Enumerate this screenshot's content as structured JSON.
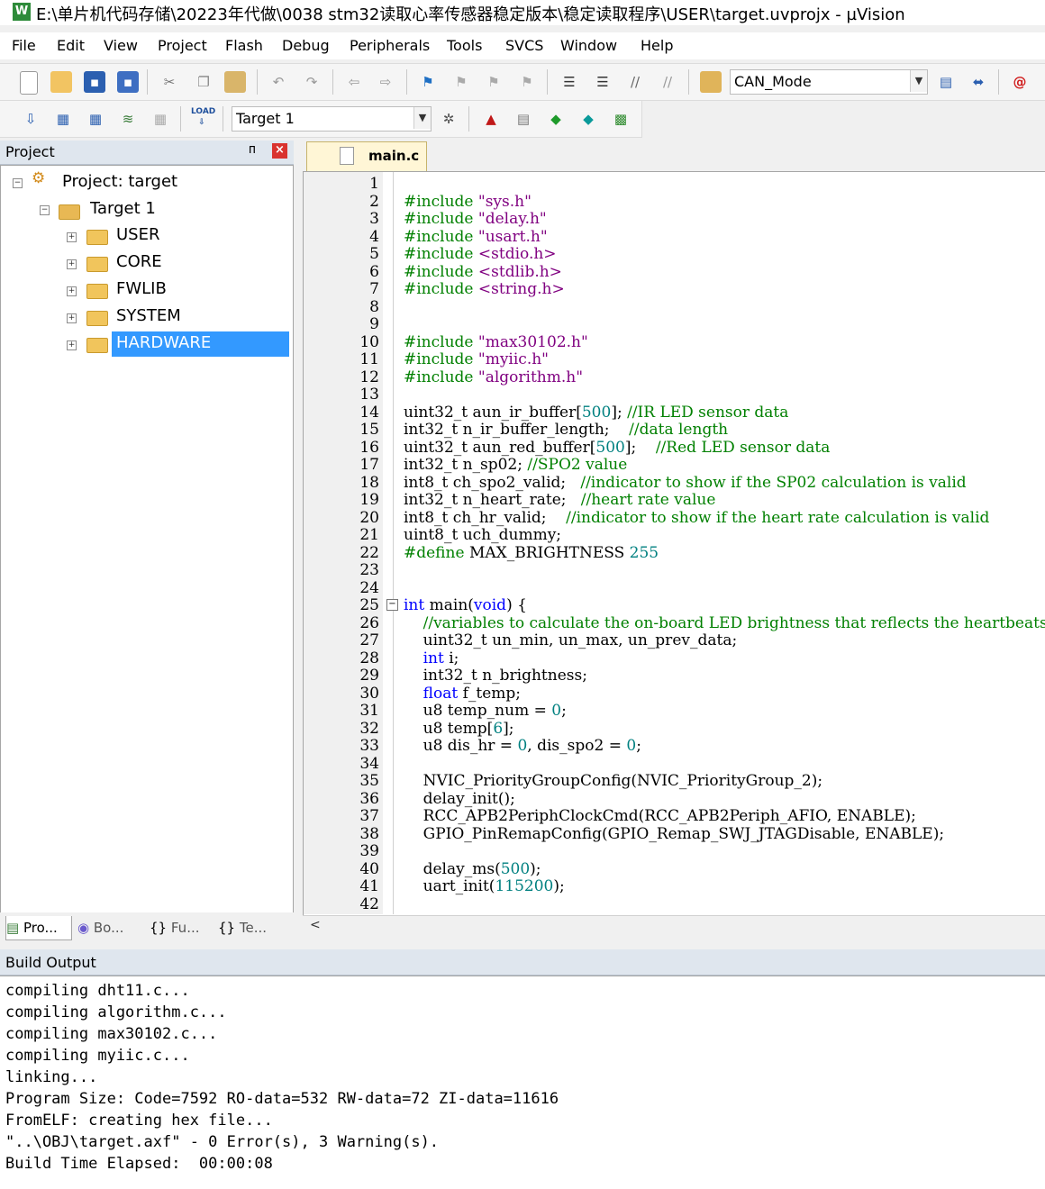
{
  "window": {
    "title": "E:\\单片机代码存储\\20223年代做\\0038 stm32读取心率传感器稳定版本\\稳定读取程序\\USER\\target.uvprojx - µVision",
    "app_icon": "W"
  },
  "menu": [
    "File",
    "Edit",
    "View",
    "Project",
    "Flash",
    "Debug",
    "Peripherals",
    "Tools",
    "SVCS",
    "Window",
    "Help"
  ],
  "toolbar": {
    "find_combo_value": "CAN_Mode",
    "target_combo_value": "Target 1",
    "load_label": "LOAD"
  },
  "project_panel": {
    "title": "Project",
    "pin_glyph": "ᴨ",
    "close_glyph": "×",
    "project_label": "Project: target",
    "target_label": "Target 1",
    "groups": [
      "USER",
      "CORE",
      "FWLIB",
      "SYSTEM",
      "HARDWARE"
    ],
    "selected_group": "HARDWARE",
    "tabs": [
      "Pro...",
      "Bo...",
      "Fu...",
      "Te..."
    ]
  },
  "editor": {
    "active_tab": "main.c",
    "line_numbers": [
      "1",
      "2",
      "3",
      "4",
      "5",
      "6",
      "7",
      "8",
      "9",
      "10",
      "11",
      "12",
      "13",
      "14",
      "15",
      "16",
      "17",
      "18",
      "19",
      "20",
      "21",
      "22",
      "23",
      "24",
      "25",
      "26",
      "27",
      "28",
      "29",
      "30",
      "31",
      "32",
      "33",
      "34",
      "35",
      "36",
      "37",
      "38",
      "39",
      "40",
      "41",
      "42"
    ]
  },
  "build_output": {
    "title": "Build Output",
    "lines": [
      "compiling dht11.c...",
      "compiling algorithm.c...",
      "compiling max30102.c...",
      "compiling myiic.c...",
      "linking...",
      "Program Size: Code=7592 RO-data=532 RW-data=72 ZI-data=11616",
      "FromELF: creating hex file...",
      "\"..\\OBJ\\target.axf\" - 0 Error(s), 3 Warning(s).",
      "Build Time Elapsed:  00:00:08"
    ]
  },
  "colors": {
    "keyword": "#0000ff",
    "preprocessor": "#008000",
    "string": "#800080",
    "comment": "#008000",
    "number": "#008080",
    "selection": "#3399ff"
  }
}
